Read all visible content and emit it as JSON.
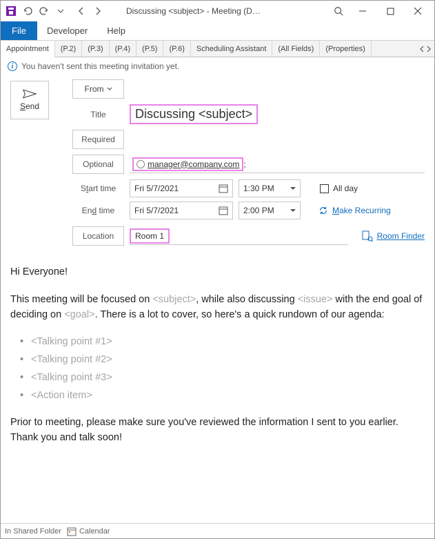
{
  "titlebar": {
    "title": "Discussing <subject>  -  Meeting  (D…"
  },
  "ribbon": {
    "file": "File",
    "developer": "Developer",
    "help": "Help"
  },
  "subtabs": {
    "appointment": "Appointment",
    "p2": "(P.2)",
    "p3": "(P.3)",
    "p4": "(P.4)",
    "p5": "(P.5)",
    "p6": "(P.6)",
    "scheduling": "Scheduling Assistant",
    "allfields": "(All Fields)",
    "properties": "(Properties)"
  },
  "info_bar": "You haven't sent this meeting invitation yet.",
  "form": {
    "send": "Send",
    "from": "From",
    "title_label": "Title",
    "title_value": "Discussing <subject>",
    "required": "Required",
    "optional": "Optional",
    "optional_value": "manager@company.com",
    "optional_suffix": ";",
    "start_label": "Start time",
    "end_label": "End time",
    "start_date": "Fri 5/7/2021",
    "start_time": "1:30 PM",
    "end_date": "Fri 5/7/2021",
    "end_time": "2:00 PM",
    "allday": "All day",
    "recurring": "Make Recurring",
    "location_label": "Location",
    "location_value": "Room 1",
    "room_finder": "Room Finder"
  },
  "body": {
    "greeting": "Hi Everyone!",
    "p1_a": "This meeting will be focused on ",
    "p1_b": "<subject>",
    "p1_c": ", while also discussing ",
    "p1_d": "<issue>",
    "p1_e": " with the end goal of deciding on ",
    "p1_f": "<goal>",
    "p1_g": ". There is a lot to cover, so here's a quick rundown of our agenda:",
    "bullets": {
      "0": "<Talking point #1>",
      "1": "<Talking point #2>",
      "2": "<Talking point #3>",
      "3": "<Action item>"
    },
    "p2": "Prior to meeting, please make sure you've reviewed the information I sent to you earlier. Thank you and talk soon!"
  },
  "status": {
    "folder": "In Shared Folder",
    "calendar": "Calendar"
  }
}
